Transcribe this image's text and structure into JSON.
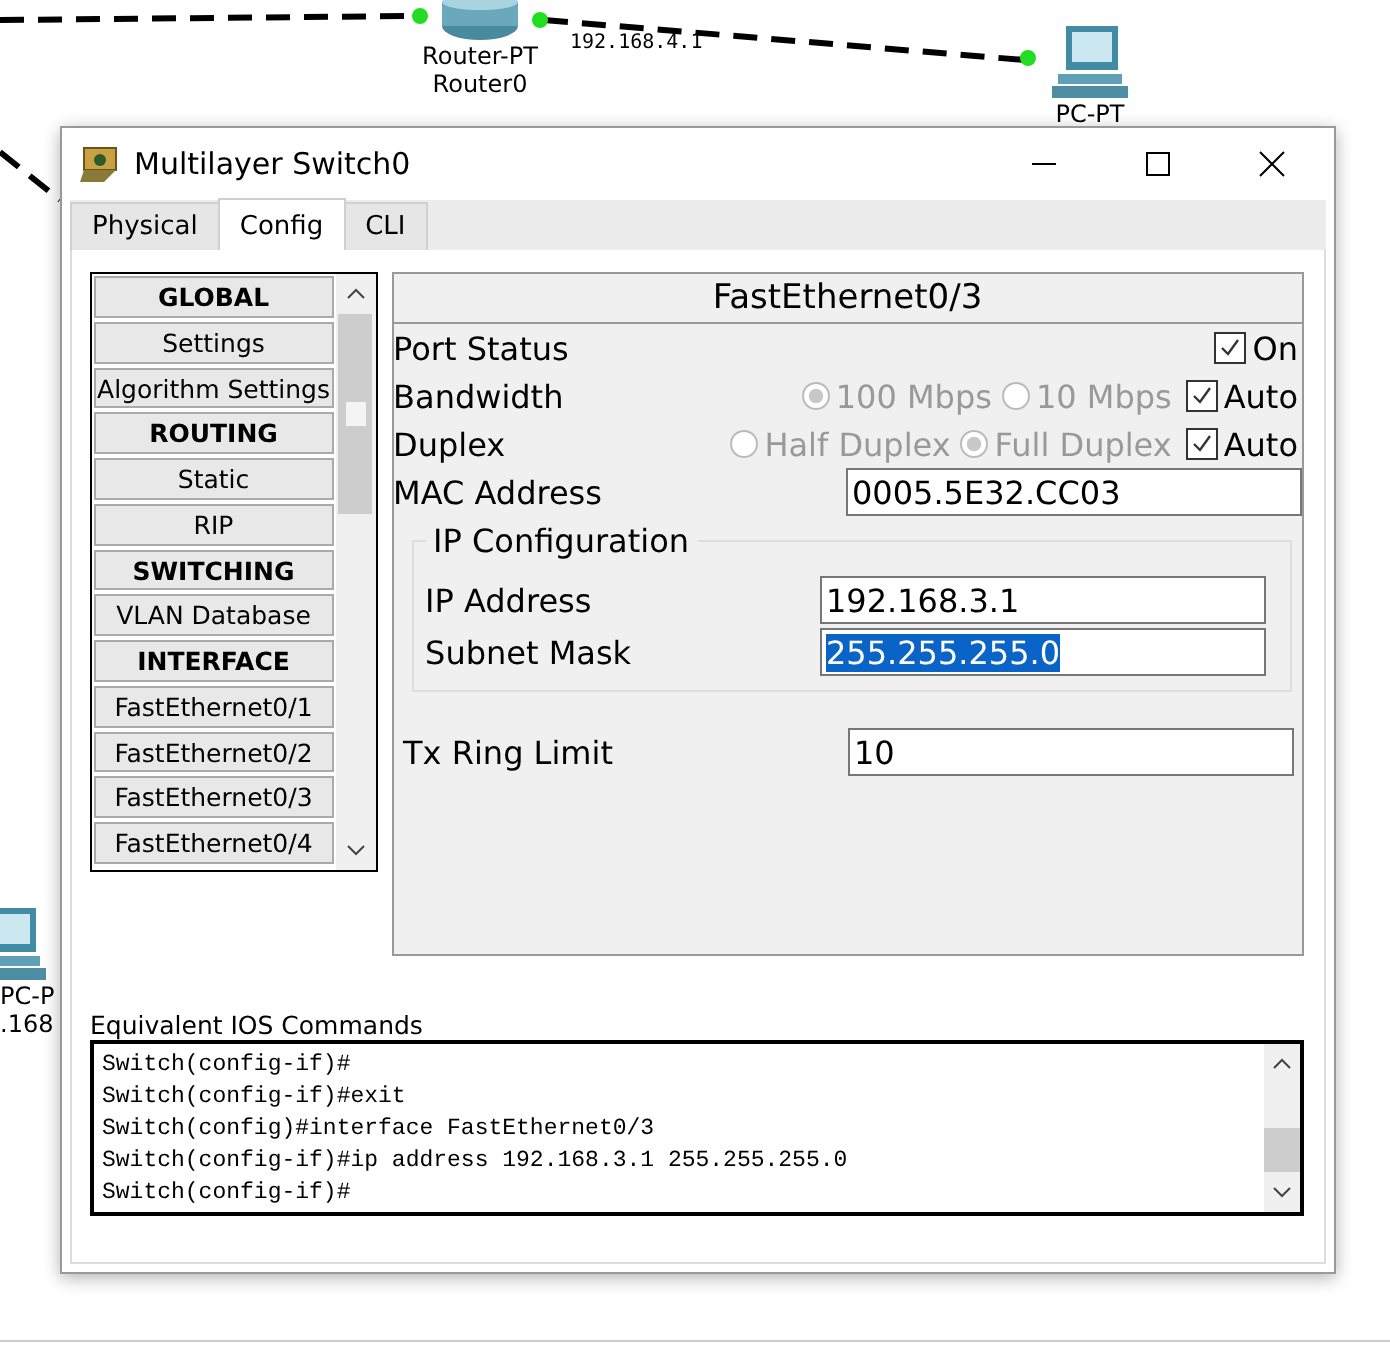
{
  "canvas": {
    "devices": [
      {
        "kind": "router",
        "model": "Router-PT",
        "name": "Router0"
      },
      {
        "kind": "pc",
        "model": "PC-PT"
      },
      {
        "kind": "pc-left",
        "model": "PC-P",
        "name": ".168"
      }
    ],
    "link_label": "192.168.4.1"
  },
  "window": {
    "title": "Multilayer Switch0"
  },
  "tabs": [
    {
      "label": "Physical",
      "selected": false
    },
    {
      "label": "Config",
      "selected": true
    },
    {
      "label": "CLI",
      "selected": false
    }
  ],
  "sidebar": {
    "items": [
      {
        "label": "GLOBAL",
        "kind": "header"
      },
      {
        "label": "Settings",
        "kind": "item"
      },
      {
        "label": "Algorithm Settings",
        "kind": "item"
      },
      {
        "label": "ROUTING",
        "kind": "header"
      },
      {
        "label": "Static",
        "kind": "item"
      },
      {
        "label": "RIP",
        "kind": "item"
      },
      {
        "label": "SWITCHING",
        "kind": "header"
      },
      {
        "label": "VLAN Database",
        "kind": "item"
      },
      {
        "label": "INTERFACE",
        "kind": "header"
      },
      {
        "label": "FastEthernet0/1",
        "kind": "item"
      },
      {
        "label": "FastEthernet0/2",
        "kind": "item"
      },
      {
        "label": "FastEthernet0/3",
        "kind": "item"
      },
      {
        "label": "FastEthernet0/4",
        "kind": "item"
      }
    ]
  },
  "interface": {
    "title": "FastEthernet0/3",
    "port_status": {
      "label": "Port Status",
      "option": "On",
      "checked": true
    },
    "bandwidth": {
      "label": "Bandwidth",
      "disabled": true,
      "options": [
        {
          "label": "100 Mbps",
          "selected": true
        },
        {
          "label": "10 Mbps",
          "selected": false
        }
      ],
      "auto": {
        "label": "Auto",
        "checked": true
      }
    },
    "duplex": {
      "label": "Duplex",
      "disabled": true,
      "options": [
        {
          "label": "Half Duplex",
          "selected": false
        },
        {
          "label": "Full Duplex",
          "selected": true
        }
      ],
      "auto": {
        "label": "Auto",
        "checked": true
      }
    },
    "mac_address": {
      "label": "MAC Address",
      "value": "0005.5E32.CC03"
    },
    "ip_configuration": {
      "legend": "IP Configuration",
      "fields": [
        {
          "label": "IP Address",
          "value": "192.168.3.1",
          "highlighted": false
        },
        {
          "label": "Subnet Mask",
          "value": "255.255.255.0",
          "highlighted": true
        }
      ]
    },
    "tx_ring_limit": {
      "label": "Tx Ring Limit",
      "value": "10"
    }
  },
  "console": {
    "label": "Equivalent IOS Commands",
    "lines": [
      "Switch(config-if)#",
      "Switch(config-if)#exit",
      "Switch(config)#interface FastEthernet0/3",
      "Switch(config-if)#ip address 192.168.3.1 255.255.255.0",
      "Switch(config-if)#"
    ]
  }
}
